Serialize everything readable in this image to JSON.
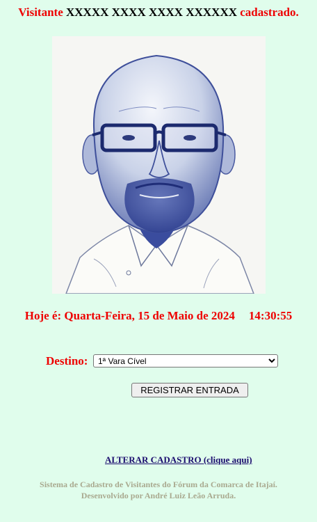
{
  "header": {
    "prefix": "Visitante",
    "name": "XXXXX XXXX XXXX XXXXXX",
    "suffix": "cadastrado."
  },
  "photo": {
    "icon": "visitor-portrait"
  },
  "datetime": {
    "date_text": "Hoje é: Quarta-Feira, 15 de Maio de 2024",
    "time_text": "14:30:55"
  },
  "destination": {
    "label": "Destino:",
    "selected": "1ª Vara Cível"
  },
  "register_button": {
    "label": "REGISTRAR ENTRADA"
  },
  "alter_link": {
    "label": "ALTERAR CADASTRO (clique aqui)"
  },
  "footer": {
    "line1": "Sistema de Cadastro de Visitantes do Fórum da Comarca de Itajaí.",
    "line2": "Desenvolvido por André Luiz Leão Arruda."
  },
  "colors": {
    "background": "#e0fdec",
    "accent_red": "#ee0000",
    "link": "#1a0b6e",
    "footer_text": "#a9a98f"
  }
}
